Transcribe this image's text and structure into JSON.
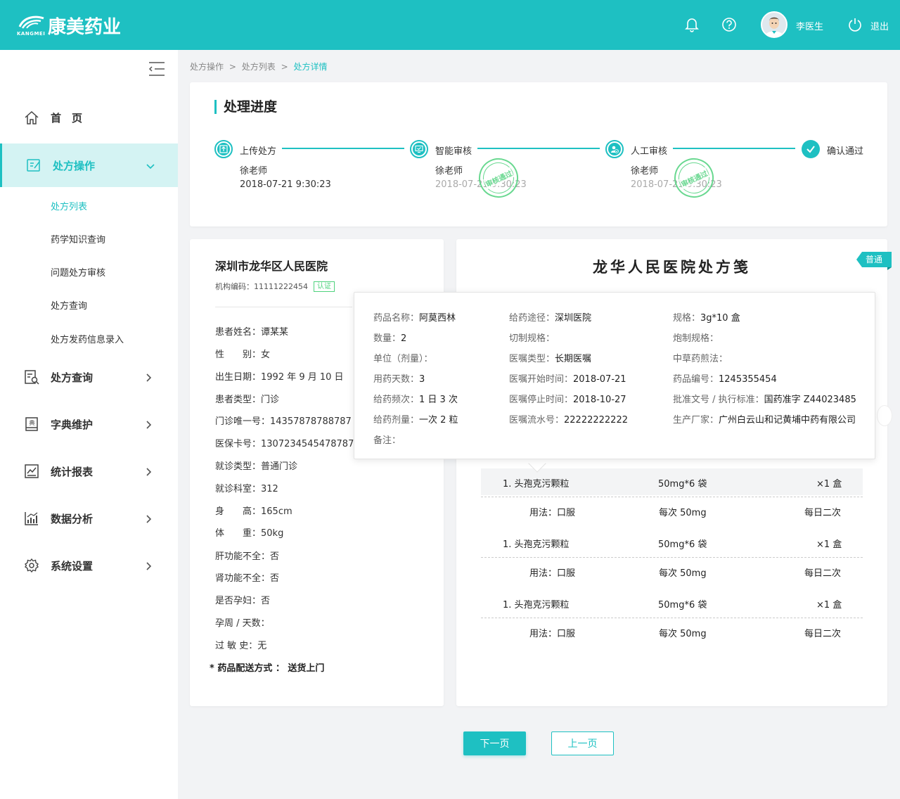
{
  "brand": {
    "name": "康美药业",
    "sub": "KANGMEI"
  },
  "header": {
    "user_name": "李医生",
    "logout_label": "退出"
  },
  "sidebar": {
    "items": [
      {
        "label": "首　页",
        "icon": "home-icon"
      },
      {
        "label": "处方操作",
        "icon": "prescription-icon",
        "active": true
      },
      {
        "label": "处方查询",
        "icon": "query-icon"
      },
      {
        "label": "字典维护",
        "icon": "dictionary-icon"
      },
      {
        "label": "统计报表",
        "icon": "report-icon"
      },
      {
        "label": "数据分析",
        "icon": "analytics-icon"
      },
      {
        "label": "系统设置",
        "icon": "gear-icon"
      }
    ],
    "sub_items": [
      "处方列表",
      "药学知识查询",
      "问题处方审核",
      "处方查询",
      "处方发药信息录入"
    ]
  },
  "breadcrumb": {
    "items": [
      "处方操作",
      "处方列表",
      "处方详情"
    ],
    "separator": ">"
  },
  "progress": {
    "title": "处理进度",
    "steps": [
      {
        "name": "上传处方",
        "user": "徐老师",
        "time": "2018-07-21  9:30:23"
      },
      {
        "name": "智能审核",
        "user": "徐老师",
        "time": "2018-07-21  9:30:23",
        "stamp": "审核通过"
      },
      {
        "name": "人工审核",
        "user": "徐老师",
        "time": "2018-07-21  9:30:23",
        "stamp": "审核通过"
      },
      {
        "name": "确认通过"
      }
    ]
  },
  "patient": {
    "hospital": "深圳市龙华区人民医院",
    "org_code": "机构编码：11111222454",
    "cert": "认证",
    "fields": [
      "患者姓名：谭某某",
      "性　　别：女",
      "出生日期：1992 年 9 月 10 日",
      "患者类型：门诊",
      "门诊唯一号：14357878788787",
      "医保卡号：13072345454787878",
      "就诊类型：普通门诊",
      "就诊科室：312",
      "身　　高：165cm",
      "体　　重：50kg",
      "肝功能不全：否",
      "肾功能不全：否",
      "是否孕妇：否",
      "孕周 / 天数：",
      "过  敏  史：无"
    ],
    "delivery": "* 药品配送方式 ： 送货上门"
  },
  "prescription": {
    "title": "龙华人民医院处方笺",
    "tag": "普通",
    "meds": [
      {
        "name": "1. 头孢克污颗粒",
        "spec": "50mg*6 袋",
        "qty": "×1 盒",
        "usage": "用法：口服",
        "dose": "每次 50mg",
        "freq": "每日二次"
      },
      {
        "name": "1. 头孢克污颗粒",
        "spec": "50mg*6 袋",
        "qty": "×1 盒",
        "usage": "用法：口服",
        "dose": "每次 50mg",
        "freq": "每日二次"
      },
      {
        "name": "1. 头孢克污颗粒",
        "spec": "50mg*6 袋",
        "qty": "×1 盒",
        "usage": "用法：口服",
        "dose": "每次 50mg",
        "freq": "每日二次"
      }
    ]
  },
  "popup": {
    "col1": [
      {
        "k": "药品名称：",
        "v": "阿莫西林"
      },
      {
        "k": "数量：",
        "v": "2"
      },
      {
        "k": "单位（剂量）：",
        "v": ""
      },
      {
        "k": "用药天数：",
        "v": "3"
      },
      {
        "k": "给药频次：",
        "v": "1 日 3 次"
      },
      {
        "k": "给药剂量：",
        "v": "一次 2 粒"
      },
      {
        "k": "备注：",
        "v": ""
      }
    ],
    "col2": [
      {
        "k": "给药途径：",
        "v": "深圳医院"
      },
      {
        "k": "切制规格：",
        "v": ""
      },
      {
        "k": "医嘱类型：",
        "v": "长期医嘱"
      },
      {
        "k": "医嘱开始时间：",
        "v": "2018-07-21"
      },
      {
        "k": "医嘱停止时间：",
        "v": "2018-10-27"
      },
      {
        "k": "医嘱流水号：",
        "v": "22222222222"
      }
    ],
    "col3": [
      {
        "k": "规格：",
        "v": "3g*10 盒"
      },
      {
        "k": "炮制规格：",
        "v": ""
      },
      {
        "k": "中草药煎法：",
        "v": ""
      },
      {
        "k": "药品编号：",
        "v": "1245355454"
      },
      {
        "k": "批准文号 / 执行标准：",
        "v": "国药准字 Z44023485"
      },
      {
        "k": "生产厂家：",
        "v": "广州白云山和记黄埔中药有限公司"
      }
    ]
  },
  "actions": {
    "next": "下一页",
    "prev": "上一页"
  },
  "colors": {
    "accent": "#1ec0c2",
    "stamp": "#4fd27d"
  }
}
